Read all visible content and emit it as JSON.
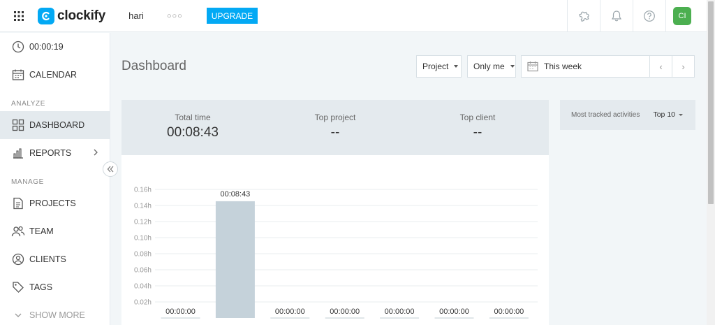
{
  "header": {
    "logo_text": "clockify",
    "workspace": "hari",
    "more_dots": "○○○",
    "upgrade_label": "UPGRADE",
    "avatar_initials": "CI"
  },
  "sidebar": {
    "timer": "00:00:19",
    "calendar": "CALENDAR",
    "analyze_label": "ANALYZE",
    "dashboard": "DASHBOARD",
    "reports": "REPORTS",
    "manage_label": "MANAGE",
    "projects": "PROJECTS",
    "team": "TEAM",
    "clients": "CLIENTS",
    "tags": "TAGS",
    "show_more": "SHOW MORE"
  },
  "main": {
    "title": "Dashboard",
    "filter_group": "Project",
    "filter_user": "Only me",
    "date_range": "This week",
    "prev": "‹",
    "next": "›"
  },
  "stats": {
    "total_time_label": "Total time",
    "total_time_value": "00:08:43",
    "top_project_label": "Top project",
    "top_project_value": "--",
    "top_client_label": "Top client",
    "top_client_value": "--"
  },
  "activities": {
    "label": "Most tracked activities",
    "top_select": "Top 10"
  },
  "colors": {
    "accent": "#03a9f4",
    "bar": "#c5d2da",
    "avatar": "#4caf50",
    "panel": "#e4eaee"
  },
  "chart_data": {
    "type": "bar",
    "ylabel": "",
    "yticks": [
      "0.16h",
      "0.14h",
      "0.12h",
      "0.10h",
      "0.08h",
      "0.06h",
      "0.04h",
      "0.02h"
    ],
    "ylim": [
      0,
      0.17
    ],
    "values": [
      0,
      0.1453,
      0,
      0,
      0,
      0,
      0
    ],
    "value_labels": [
      "00:00:00",
      "00:08:43",
      "00:00:00",
      "00:00:00",
      "00:00:00",
      "00:00:00",
      "00:00:00"
    ]
  }
}
